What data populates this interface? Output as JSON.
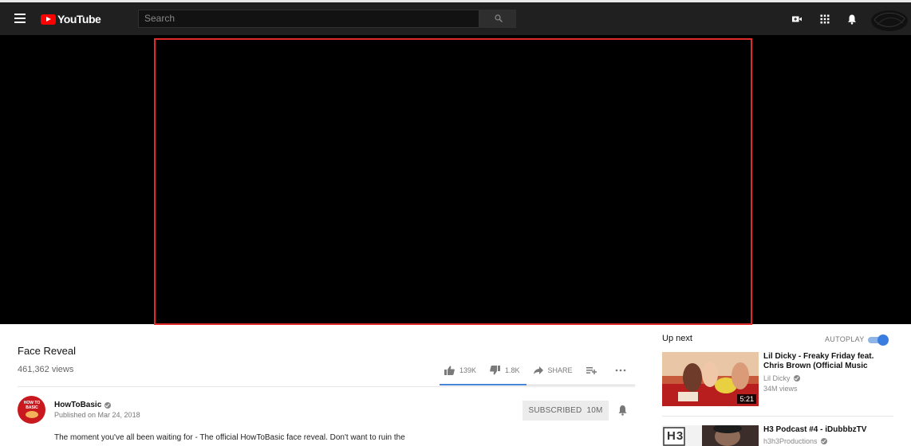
{
  "header": {
    "logo_text": "YouTube",
    "search_placeholder": "Search",
    "avatar_label": "blacked-out user avatar"
  },
  "video": {
    "title": "Face Reveal",
    "views": "461,362 views",
    "likes": "139K",
    "dislikes": "1.8K",
    "share_label": "SHARE",
    "like_ratio": 0.987
  },
  "channel": {
    "name": "HowToBasic",
    "avatar_text": "HOW TO BASIC",
    "published": "Published on Mar 24, 2018",
    "subscribe_label": "SUBSCRIBED",
    "subscriber_count": "10M",
    "description": "The moment you've all been waiting for - The official HowToBasic face reveal. Don't want to ruin the"
  },
  "sidebar": {
    "upnext_label": "Up next",
    "autoplay_label": "AUTOPLAY",
    "autoplay_on": true,
    "videos": [
      {
        "title": "Lil Dicky - Freaky Friday feat. Chris Brown (Official Music",
        "channel": "Lil Dicky",
        "views": "34M views",
        "duration": "5:21"
      },
      {
        "title": "H3 Podcast #4 - iDubbbzTV",
        "channel": "h3h3Productions",
        "thumb_text": "H3"
      }
    ]
  },
  "colors": {
    "header_bg": "#202020",
    "youtube_red": "#ff0000",
    "player_highlight": "#e02b2b",
    "accent_blue": "#3a7de0"
  }
}
